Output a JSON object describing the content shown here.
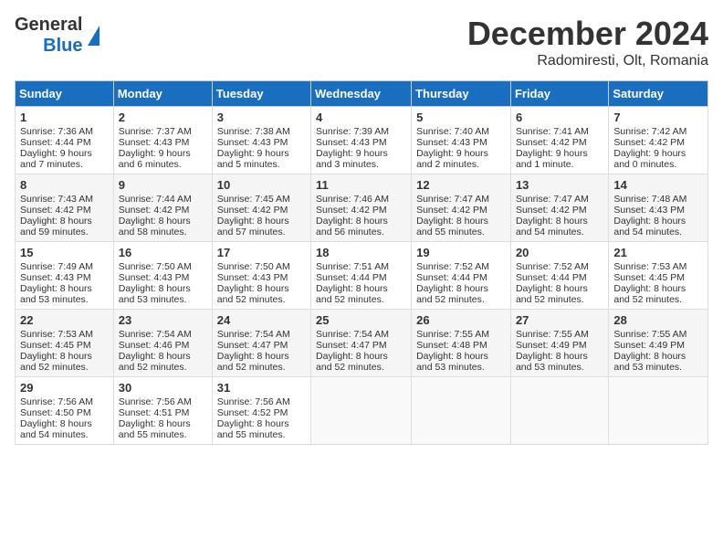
{
  "header": {
    "logo_line1": "General",
    "logo_line2": "Blue",
    "month": "December 2024",
    "location": "Radomiresti, Olt, Romania"
  },
  "days_of_week": [
    "Sunday",
    "Monday",
    "Tuesday",
    "Wednesday",
    "Thursday",
    "Friday",
    "Saturday"
  ],
  "weeks": [
    [
      {
        "day": "1",
        "sunrise": "7:36 AM",
        "sunset": "4:44 PM",
        "daylight": "9 hours and 7 minutes."
      },
      {
        "day": "2",
        "sunrise": "7:37 AM",
        "sunset": "4:43 PM",
        "daylight": "9 hours and 6 minutes."
      },
      {
        "day": "3",
        "sunrise": "7:38 AM",
        "sunset": "4:43 PM",
        "daylight": "9 hours and 5 minutes."
      },
      {
        "day": "4",
        "sunrise": "7:39 AM",
        "sunset": "4:43 PM",
        "daylight": "9 hours and 3 minutes."
      },
      {
        "day": "5",
        "sunrise": "7:40 AM",
        "sunset": "4:43 PM",
        "daylight": "9 hours and 2 minutes."
      },
      {
        "day": "6",
        "sunrise": "7:41 AM",
        "sunset": "4:42 PM",
        "daylight": "9 hours and 1 minute."
      },
      {
        "day": "7",
        "sunrise": "7:42 AM",
        "sunset": "4:42 PM",
        "daylight": "9 hours and 0 minutes."
      }
    ],
    [
      {
        "day": "8",
        "sunrise": "7:43 AM",
        "sunset": "4:42 PM",
        "daylight": "8 hours and 59 minutes."
      },
      {
        "day": "9",
        "sunrise": "7:44 AM",
        "sunset": "4:42 PM",
        "daylight": "8 hours and 58 minutes."
      },
      {
        "day": "10",
        "sunrise": "7:45 AM",
        "sunset": "4:42 PM",
        "daylight": "8 hours and 57 minutes."
      },
      {
        "day": "11",
        "sunrise": "7:46 AM",
        "sunset": "4:42 PM",
        "daylight": "8 hours and 56 minutes."
      },
      {
        "day": "12",
        "sunrise": "7:47 AM",
        "sunset": "4:42 PM",
        "daylight": "8 hours and 55 minutes."
      },
      {
        "day": "13",
        "sunrise": "7:47 AM",
        "sunset": "4:42 PM",
        "daylight": "8 hours and 54 minutes."
      },
      {
        "day": "14",
        "sunrise": "7:48 AM",
        "sunset": "4:43 PM",
        "daylight": "8 hours and 54 minutes."
      }
    ],
    [
      {
        "day": "15",
        "sunrise": "7:49 AM",
        "sunset": "4:43 PM",
        "daylight": "8 hours and 53 minutes."
      },
      {
        "day": "16",
        "sunrise": "7:50 AM",
        "sunset": "4:43 PM",
        "daylight": "8 hours and 53 minutes."
      },
      {
        "day": "17",
        "sunrise": "7:50 AM",
        "sunset": "4:43 PM",
        "daylight": "8 hours and 52 minutes."
      },
      {
        "day": "18",
        "sunrise": "7:51 AM",
        "sunset": "4:44 PM",
        "daylight": "8 hours and 52 minutes."
      },
      {
        "day": "19",
        "sunrise": "7:52 AM",
        "sunset": "4:44 PM",
        "daylight": "8 hours and 52 minutes."
      },
      {
        "day": "20",
        "sunrise": "7:52 AM",
        "sunset": "4:44 PM",
        "daylight": "8 hours and 52 minutes."
      },
      {
        "day": "21",
        "sunrise": "7:53 AM",
        "sunset": "4:45 PM",
        "daylight": "8 hours and 52 minutes."
      }
    ],
    [
      {
        "day": "22",
        "sunrise": "7:53 AM",
        "sunset": "4:45 PM",
        "daylight": "8 hours and 52 minutes."
      },
      {
        "day": "23",
        "sunrise": "7:54 AM",
        "sunset": "4:46 PM",
        "daylight": "8 hours and 52 minutes."
      },
      {
        "day": "24",
        "sunrise": "7:54 AM",
        "sunset": "4:47 PM",
        "daylight": "8 hours and 52 minutes."
      },
      {
        "day": "25",
        "sunrise": "7:54 AM",
        "sunset": "4:47 PM",
        "daylight": "8 hours and 52 minutes."
      },
      {
        "day": "26",
        "sunrise": "7:55 AM",
        "sunset": "4:48 PM",
        "daylight": "8 hours and 53 minutes."
      },
      {
        "day": "27",
        "sunrise": "7:55 AM",
        "sunset": "4:49 PM",
        "daylight": "8 hours and 53 minutes."
      },
      {
        "day": "28",
        "sunrise": "7:55 AM",
        "sunset": "4:49 PM",
        "daylight": "8 hours and 53 minutes."
      }
    ],
    [
      {
        "day": "29",
        "sunrise": "7:56 AM",
        "sunset": "4:50 PM",
        "daylight": "8 hours and 54 minutes."
      },
      {
        "day": "30",
        "sunrise": "7:56 AM",
        "sunset": "4:51 PM",
        "daylight": "8 hours and 55 minutes."
      },
      {
        "day": "31",
        "sunrise": "7:56 AM",
        "sunset": "4:52 PM",
        "daylight": "8 hours and 55 minutes."
      },
      null,
      null,
      null,
      null
    ]
  ]
}
